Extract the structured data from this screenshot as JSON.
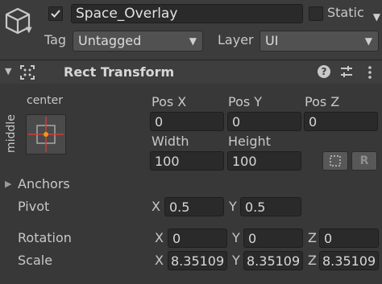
{
  "header": {
    "object_name": "Space_Overlay",
    "active_checked": true,
    "static_label": "Static",
    "static_checked": false,
    "tag_label": "Tag",
    "tag_value": "Untagged",
    "layer_label": "Layer",
    "layer_value": "UI"
  },
  "component": {
    "title": "Rect Transform",
    "anchor_preset": {
      "horizontal": "center",
      "vertical": "middle"
    },
    "pos_x_label": "Pos X",
    "pos_y_label": "Pos Y",
    "pos_z_label": "Pos Z",
    "pos_x": "0",
    "pos_y": "0",
    "pos_z": "0",
    "width_label": "Width",
    "height_label": "Height",
    "width": "100",
    "height": "100",
    "raw_edit_label": "R",
    "anchors_label": "Anchors",
    "pivot_label": "Pivot",
    "pivot_x": "0.5",
    "pivot_y": "0.5",
    "rotation_label": "Rotation",
    "rotation_x": "0",
    "rotation_y": "0",
    "rotation_z": "0",
    "scale_label": "Scale",
    "scale_x": "8.35109",
    "scale_y": "8.35109",
    "scale_z": "8.35109",
    "axis_x": "X",
    "axis_y": "Y",
    "axis_z": "Z"
  },
  "colors": {
    "panel": "#383838",
    "header_bar": "#3e3e3e",
    "field": "#2a2a2a",
    "anchor_red": "#d23a3a",
    "anchor_dot": "#e89a1a"
  }
}
